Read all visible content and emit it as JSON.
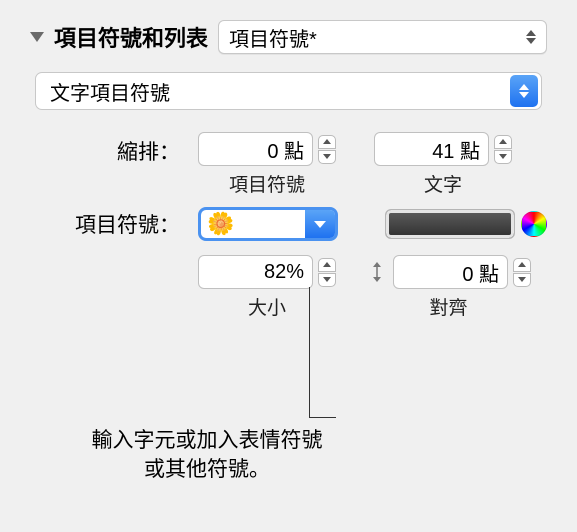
{
  "header": {
    "title": "項目符號和列表",
    "style_popup": "項目符號*"
  },
  "bullet_type_popup": "文字項目符號",
  "indent": {
    "label": "縮排：",
    "bullet_value": "0 點",
    "bullet_sublabel": "項目符號",
    "text_value": "41 點",
    "text_sublabel": "文字"
  },
  "bullet_row": {
    "label": "項目符號：",
    "emoji": "🌼"
  },
  "size": {
    "value": "82%",
    "sublabel": "大小"
  },
  "align": {
    "value": "0 點",
    "sublabel": "對齊"
  },
  "callout": {
    "line1": "輸入字元或加入表情符號",
    "line2": "或其他符號。"
  }
}
